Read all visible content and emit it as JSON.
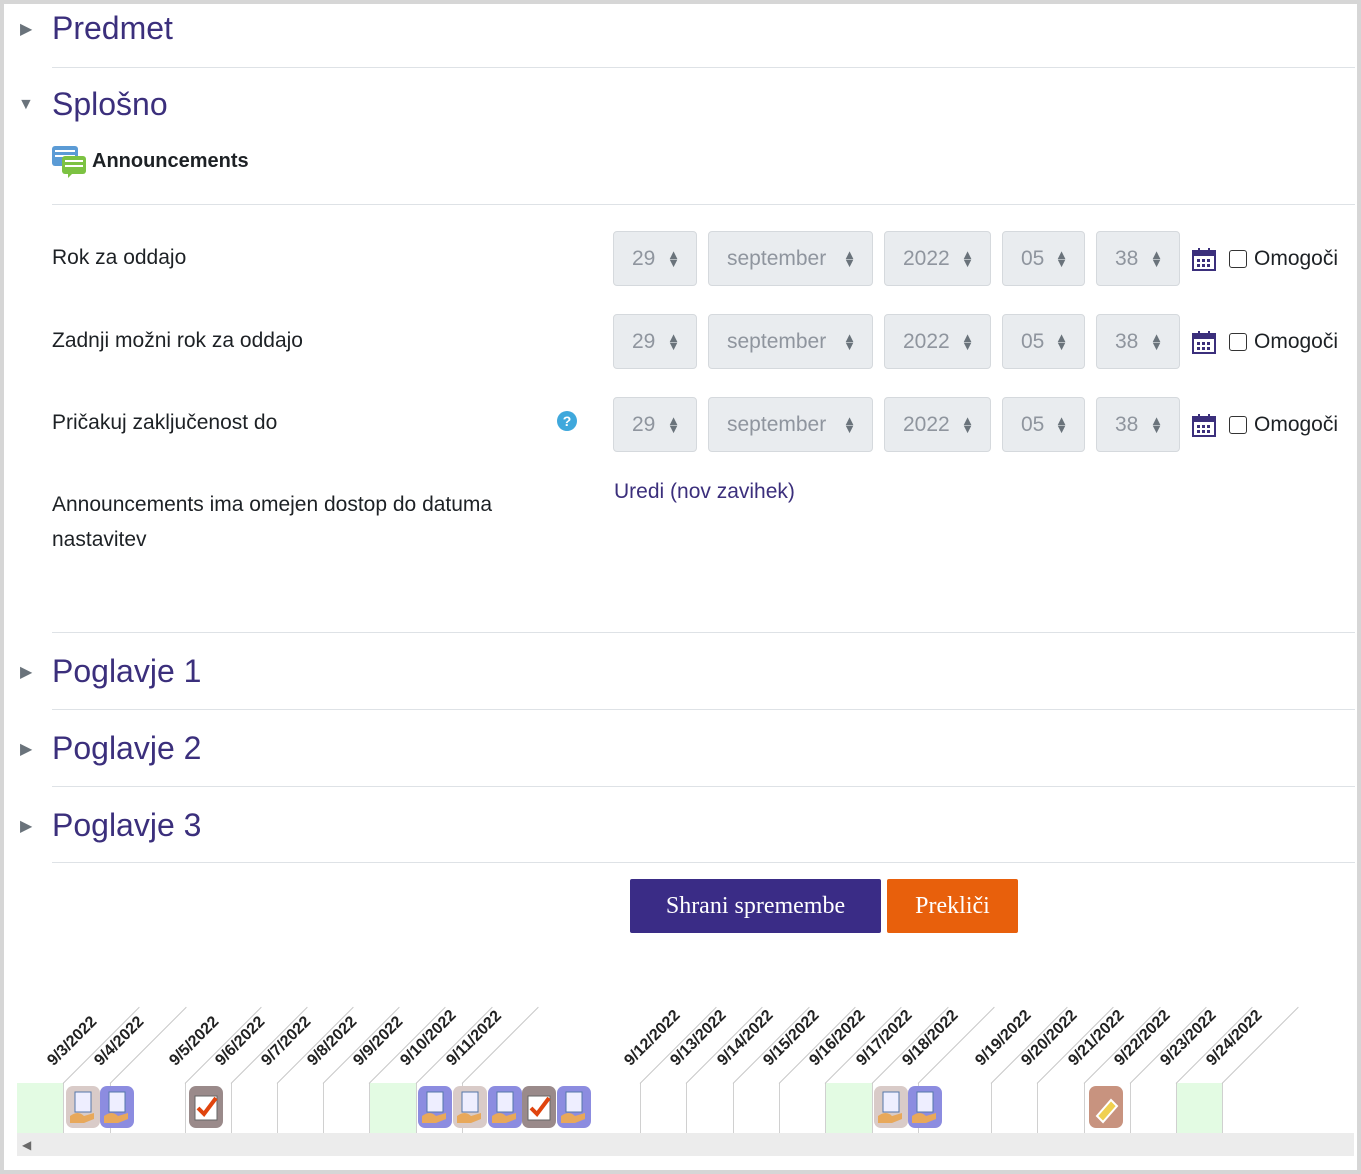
{
  "sections": [
    {
      "title": "Predmet",
      "expanded": false
    },
    {
      "title": "Splošno",
      "expanded": true
    },
    {
      "title": "Poglavje 1",
      "expanded": false
    },
    {
      "title": "Poglavje 2",
      "expanded": false
    },
    {
      "title": "Poglavje 3",
      "expanded": false
    }
  ],
  "activity": {
    "name": "Announcements",
    "icon": "forum-icon"
  },
  "dates": [
    {
      "label": "Rok za oddajo",
      "day": "29",
      "month": "september",
      "year": "2022",
      "hour": "05",
      "minute": "38",
      "enable_label": "Omogoči",
      "has_help": false
    },
    {
      "label": "Zadnji možni rok za oddajo",
      "day": "29",
      "month": "september",
      "year": "2022",
      "hour": "05",
      "minute": "38",
      "enable_label": "Omogoči",
      "has_help": false
    },
    {
      "label": "Pričakuj zaključenost do",
      "day": "29",
      "month": "september",
      "year": "2022",
      "hour": "05",
      "minute": "38",
      "enable_label": "Omogoči",
      "has_help": true
    }
  ],
  "restriction": {
    "label": "Announcements ima omejen dostop do datuma nastavitev",
    "link": "Uredi (nov zavihek)"
  },
  "buttons": {
    "save": "Shrani spremembe",
    "cancel": "Prekliči"
  },
  "colors": {
    "save": "#3a2c86",
    "cancel": "#e8600c",
    "title": "#3b2f7c"
  },
  "timeline": {
    "dates": [
      "9/3/2022",
      "9/4/2022",
      "9/5/2022",
      "9/6/2022",
      "9/7/2022",
      "9/8/2022",
      "9/9/2022",
      "9/10/2022",
      "9/11/2022",
      "9/12/2022",
      "9/13/2022",
      "9/14/2022",
      "9/15/2022",
      "9/16/2022",
      "9/17/2022",
      "9/18/2022",
      "9/19/2022",
      "9/20/2022",
      "9/21/2022",
      "9/22/2022",
      "9/23/2022",
      "9/24/2022"
    ],
    "icons": [
      {
        "date": "9/3/2022",
        "type": "assignment-icon"
      },
      {
        "date": "9/4/2022",
        "type": "assignment-icon"
      },
      {
        "date": "9/5/2022",
        "type": "checkbox-icon"
      },
      {
        "date": "9/10/2022",
        "type": "assignment-icon"
      },
      {
        "date": "9/10/2022",
        "type": "assignment-icon"
      },
      {
        "date": "9/10/2022",
        "type": "assignment-icon"
      },
      {
        "date": "9/11/2022",
        "type": "checkbox-icon"
      },
      {
        "date": "9/11/2022",
        "type": "assignment-icon"
      },
      {
        "date": "9/17/2022",
        "type": "assignment-icon"
      },
      {
        "date": "9/17/2022",
        "type": "assignment-icon"
      },
      {
        "date": "9/21/2022",
        "type": "tag-icon"
      }
    ]
  }
}
